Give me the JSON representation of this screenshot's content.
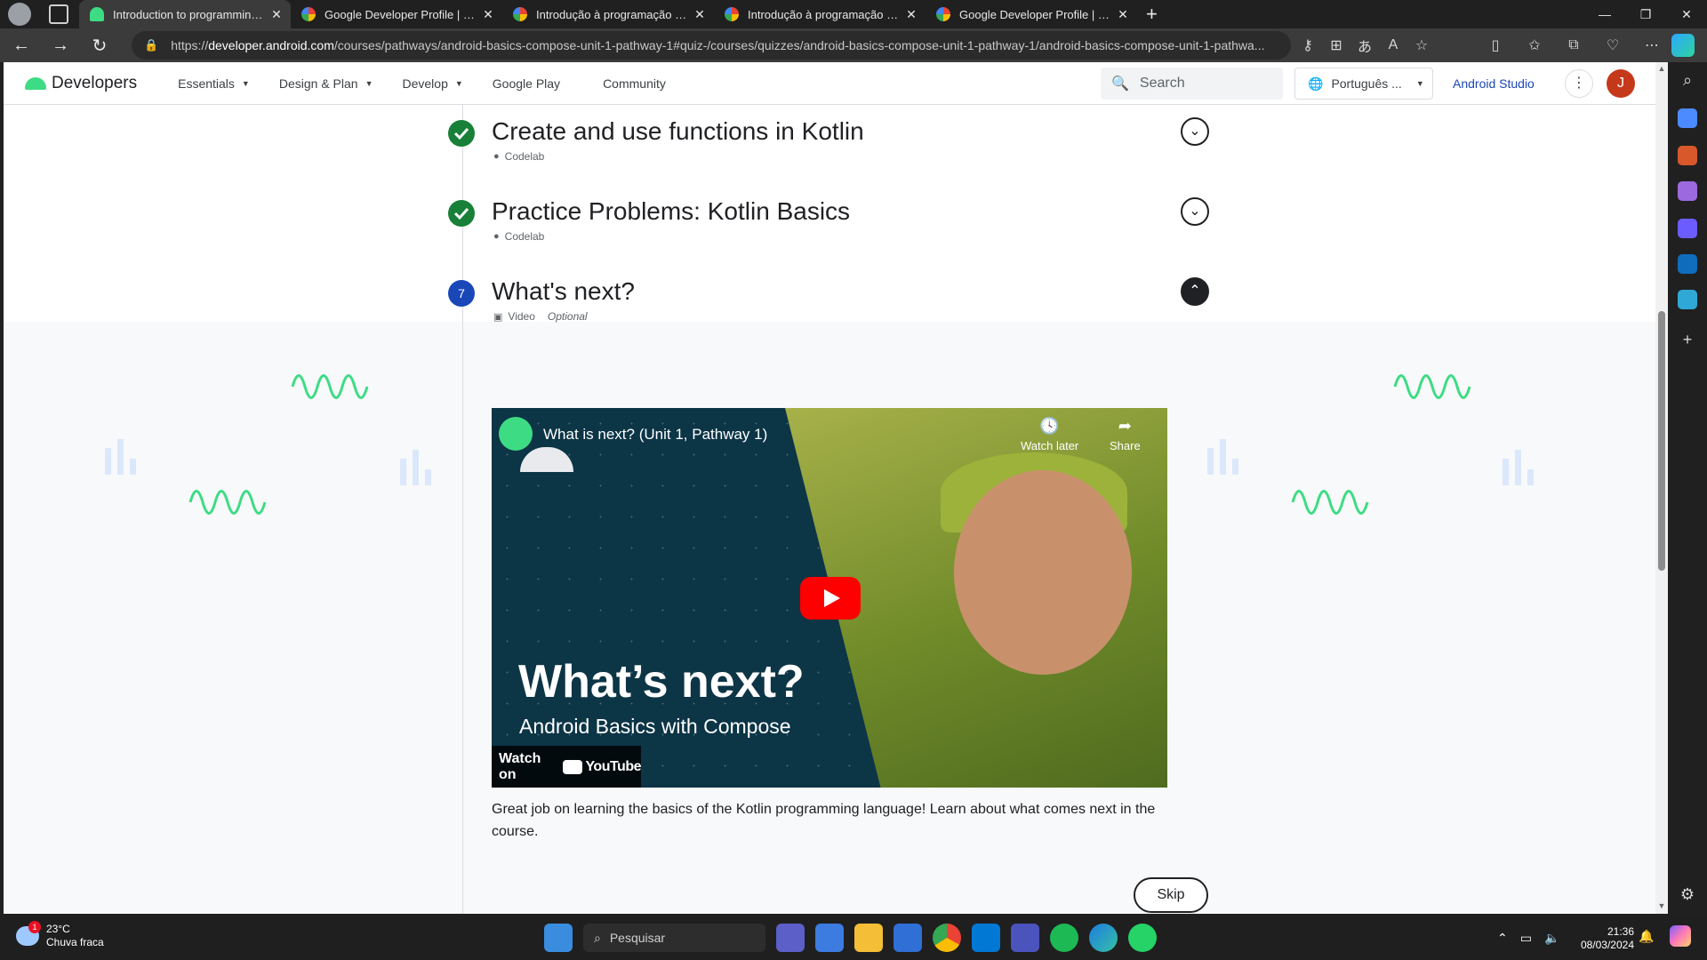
{
  "browser": {
    "tabs": [
      {
        "title": "Introduction to programming in Kotlin",
        "active": true
      },
      {
        "title": "Google Developer Profile | Google for Developers",
        "active": false
      },
      {
        "title": "Introdução à programação em Kotlin",
        "active": false
      },
      {
        "title": "Introdução à programação em Kotlin",
        "active": false
      },
      {
        "title": "Google Developer Profile | Google for Developers",
        "active": false
      }
    ],
    "close_glyph": "✕",
    "new_tab_glyph": "+",
    "url_prefix": "https://",
    "url_host": "developer.android.com",
    "url_path": "/courses/pathways/android-basics-compose-unit-1-pathway-1#quiz-/courses/quizzes/android-basics-compose-unit-1-pathway-1/android-basics-compose-unit-1-pathwa..."
  },
  "site": {
    "brand": "Developers",
    "nav": [
      {
        "label": "Essentials",
        "dropdown": true
      },
      {
        "label": "Design & Plan",
        "dropdown": true
      },
      {
        "label": "Develop",
        "dropdown": true
      },
      {
        "label": "Google Play",
        "dropdown": false
      },
      {
        "label": "Community",
        "dropdown": false
      }
    ],
    "search_placeholder": "Search",
    "language": "Português ...",
    "studio_link": "Android Studio",
    "avatar_initial": "J"
  },
  "steps": [
    {
      "title": "Create and use functions in Kotlin",
      "type": "Codelab",
      "status": "done"
    },
    {
      "title": "Practice Problems: Kotlin Basics",
      "type": "Codelab",
      "status": "done"
    },
    {
      "number": "7",
      "title": "What's next?",
      "type": "Video",
      "optional": "Optional",
      "status": "current"
    }
  ],
  "video": {
    "title": "What is next? (Unit 1, Pathway 1)",
    "watch_later": "Watch later",
    "share": "Share",
    "headline": "What’s next?",
    "subheadline": "Android Basics with Compose",
    "watch_on": "Watch on",
    "youtube": "YouTube"
  },
  "description": "Great job on learning the basics of the Kotlin programming language! Learn about what comes next in the course.",
  "skip_label": "Skip",
  "taskbar": {
    "temperature": "23°C",
    "weather": "Chuva fraca",
    "weather_badge": "1",
    "search_placeholder": "Pesquisar",
    "time": "21:36",
    "date": "08/03/2024"
  },
  "colors": {
    "accent_blue": "#1a47b8",
    "done_green": "#188038",
    "avatar_red": "#c5391a",
    "android_green": "#3ddc84"
  }
}
